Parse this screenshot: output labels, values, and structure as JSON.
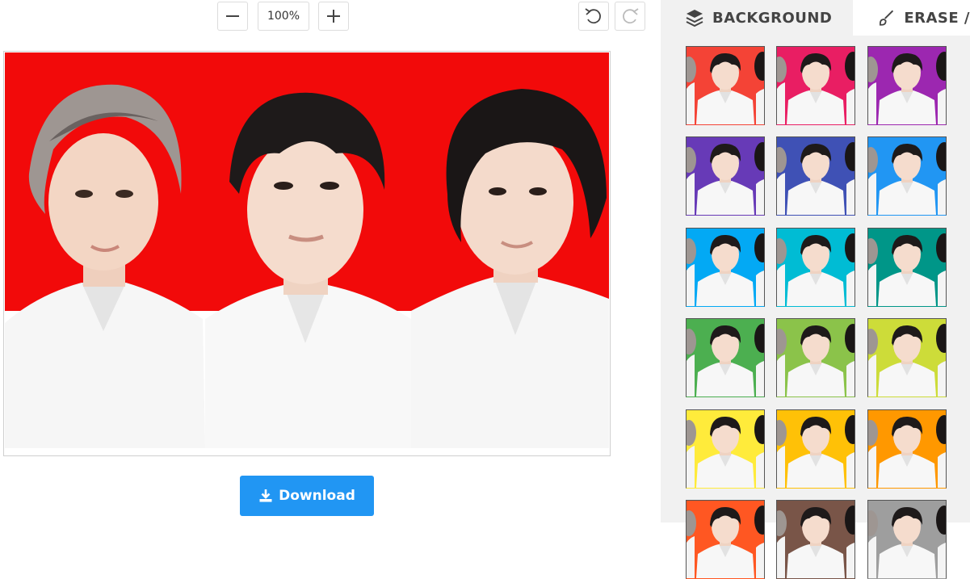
{
  "toolbar": {
    "zoom_out_icon": "minus-icon",
    "zoom_level": "100%",
    "zoom_in_icon": "plus-icon",
    "undo_icon": "undo-icon",
    "redo_icon": "redo-icon"
  },
  "download": {
    "label": "Download",
    "icon": "download-icon"
  },
  "panel": {
    "tabs": [
      {
        "label": "BACKGROUND",
        "icon": "layers-icon",
        "active": true
      },
      {
        "label": "ERASE /",
        "icon": "brush-icon",
        "active": false
      }
    ],
    "swatches": [
      "#f44336",
      "#e91e63",
      "#9c27b0",
      "#673ab7",
      "#3f51b5",
      "#2196f3",
      "#03a9f4",
      "#00bcd4",
      "#009688",
      "#4caf50",
      "#8bc34a",
      "#cddc39",
      "#ffeb3b",
      "#ffc107",
      "#ff9800",
      "#ff5722",
      "#795548",
      "#9e9e9e"
    ]
  },
  "photo": {
    "background_color": "#f20a0a"
  }
}
